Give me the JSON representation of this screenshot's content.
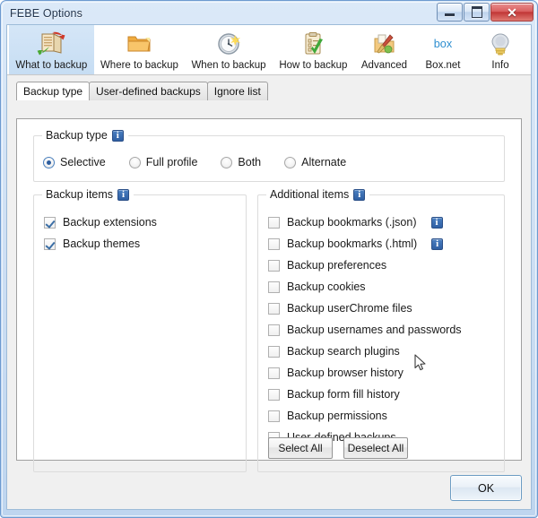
{
  "window": {
    "title": "FEBE Options",
    "controls": {
      "minimize": "minimize-button",
      "maximize": "maximize-button",
      "close": "✕"
    }
  },
  "toolbar": {
    "items": [
      {
        "label": "What to backup",
        "icon": "book-backup-icon",
        "selected": true
      },
      {
        "label": "Where to backup",
        "icon": "folder-icon",
        "selected": false
      },
      {
        "label": "When to backup",
        "icon": "clock-icon",
        "selected": false
      },
      {
        "label": "How to backup",
        "icon": "clipboard-check-icon",
        "selected": false
      },
      {
        "label": "Advanced",
        "icon": "toolbox-icon",
        "selected": false
      },
      {
        "label": "Box.net",
        "icon": "box-logo-icon",
        "selected": false
      },
      {
        "label": "Info",
        "icon": "lightbulb-icon",
        "selected": false
      }
    ]
  },
  "tabs": [
    {
      "label": "Backup type",
      "active": true
    },
    {
      "label": "User-defined backups",
      "active": false
    },
    {
      "label": "Ignore list",
      "active": false
    }
  ],
  "backup_type_group": {
    "title": "Backup type",
    "info_icon": "info-icon",
    "options": [
      {
        "label": "Selective",
        "checked": true
      },
      {
        "label": "Full profile",
        "checked": false
      },
      {
        "label": "Both",
        "checked": false
      },
      {
        "label": "Alternate",
        "checked": false
      }
    ]
  },
  "backup_items_group": {
    "title": "Backup items",
    "info_icon": "info-icon",
    "items": [
      {
        "label": "Backup extensions",
        "checked": true
      },
      {
        "label": "Backup themes",
        "checked": true
      }
    ]
  },
  "additional_items_group": {
    "title": "Additional items",
    "info_icon": "info-icon",
    "items": [
      {
        "label": "Backup bookmarks (.json)",
        "checked": false,
        "info": true
      },
      {
        "label": "Backup bookmarks (.html)",
        "checked": false,
        "info": true
      },
      {
        "label": "Backup preferences",
        "checked": false,
        "info": false
      },
      {
        "label": "Backup cookies",
        "checked": false,
        "info": false
      },
      {
        "label": "Backup userChrome files",
        "checked": false,
        "info": false
      },
      {
        "label": "Backup usernames and passwords",
        "checked": false,
        "info": false
      },
      {
        "label": "Backup search plugins",
        "checked": false,
        "info": false
      },
      {
        "label": "Backup browser history",
        "checked": false,
        "info": false
      },
      {
        "label": "Backup form fill history",
        "checked": false,
        "info": false
      },
      {
        "label": "Backup permissions",
        "checked": false,
        "info": false
      },
      {
        "label": "User-defined backups",
        "checked": false,
        "info": false
      }
    ],
    "select_all_label": "Select All",
    "deselect_all_label": "Deselect All"
  },
  "footer": {
    "ok_label": "OK"
  },
  "colors": {
    "accent_blue": "#2d5d9e",
    "title_bar": "#cfe0f4",
    "selected_tool_bg": "#c6ddf3",
    "close_button": "#c03434"
  }
}
